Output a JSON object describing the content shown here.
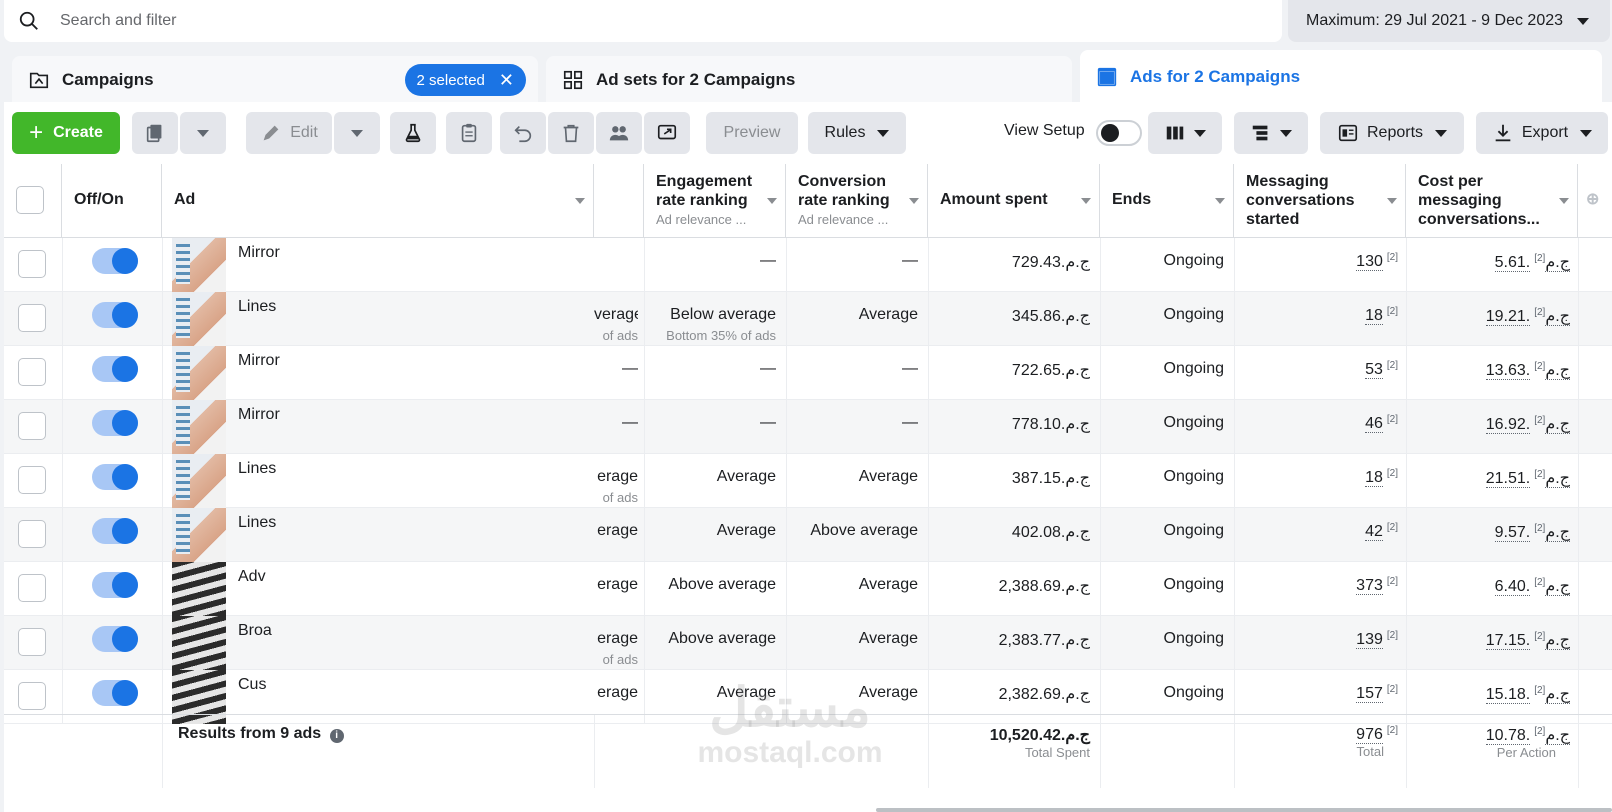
{
  "search": {
    "placeholder": "Search and filter"
  },
  "date_range": {
    "label": "Maximum: 29 Jul 2021 - 9 Dec 2023"
  },
  "tabs": [
    {
      "label": "Campaigns",
      "badge": "2 selected"
    },
    {
      "label": "Ad sets for 2 Campaigns"
    },
    {
      "label": "Ads for 2 Campaigns"
    }
  ],
  "toolbar": {
    "create": "Create",
    "edit": "Edit",
    "preview": "Preview",
    "rules": "Rules",
    "view_setup": "View Setup",
    "reports": "Reports",
    "export": "Export"
  },
  "columns": {
    "off_on": "Off/On",
    "ad": "Ad",
    "engagement_line1": "Engagement",
    "engagement_line2": "rate ranking",
    "engagement_sub": "Ad relevance ...",
    "conversion_line1": "Conversion",
    "conversion_line2": "rate ranking",
    "conversion_sub": "Ad relevance ...",
    "amount_spent": "Amount spent",
    "ends": "Ends",
    "messaging_line1": "Messaging",
    "messaging_line2": "conversations",
    "messaging_line3": "started",
    "cost_line1": "Cost per",
    "cost_line2": "messaging",
    "cost_line3": "conversations..."
  },
  "rows": [
    {
      "name": "Mirror",
      "thumb": "face",
      "quality": "",
      "quality_sub": "",
      "engagement": "—",
      "engagement_sub": "",
      "conversion": "—",
      "amount": "729.43.ج.م",
      "ends": "Ongoing",
      "messaging": "130",
      "cost": "5.61.ج.م"
    },
    {
      "name": "Lines",
      "thumb": "face",
      "quality": "verage",
      "quality_sub": "of ads",
      "engagement": "Below average",
      "engagement_sub": "Bottom 35% of ads",
      "conversion": "Average",
      "amount": "345.86.ج.م",
      "ends": "Ongoing",
      "messaging": "18",
      "cost": "19.21.ج.م"
    },
    {
      "name": "Mirror",
      "thumb": "face",
      "quality": "—",
      "quality_sub": "",
      "engagement": "—",
      "engagement_sub": "",
      "conversion": "—",
      "amount": "722.65.ج.م",
      "ends": "Ongoing",
      "messaging": "53",
      "cost": "13.63.ج.م"
    },
    {
      "name": "Mirror",
      "thumb": "face",
      "quality": "—",
      "quality_sub": "",
      "engagement": "—",
      "engagement_sub": "",
      "conversion": "—",
      "amount": "778.10.ج.م",
      "ends": "Ongoing",
      "messaging": "46",
      "cost": "16.92.ج.م"
    },
    {
      "name": "Lines",
      "thumb": "face",
      "quality": "erage",
      "quality_sub": "of ads",
      "engagement": "Average",
      "engagement_sub": "",
      "conversion": "Average",
      "amount": "387.15.ج.م",
      "ends": "Ongoing",
      "messaging": "18",
      "cost": "21.51.ج.م"
    },
    {
      "name": "Lines",
      "thumb": "face",
      "quality": "erage",
      "quality_sub": "",
      "engagement": "Average",
      "engagement_sub": "",
      "conversion": "Above average",
      "amount": "402.08.ج.م",
      "ends": "Ongoing",
      "messaging": "42",
      "cost": "9.57.ج.م"
    },
    {
      "name": "Adv",
      "thumb": "stripe",
      "quality": "erage",
      "quality_sub": "",
      "engagement": "Above average",
      "engagement_sub": "",
      "conversion": "Average",
      "amount": "2,388.69.ج.م",
      "ends": "Ongoing",
      "messaging": "373",
      "cost": "6.40.ج.م"
    },
    {
      "name": "Broa",
      "thumb": "stripe",
      "quality": "erage",
      "quality_sub": "of ads",
      "engagement": "Above average",
      "engagement_sub": "",
      "conversion": "Average",
      "amount": "2,383.77.ج.م",
      "ends": "Ongoing",
      "messaging": "139",
      "cost": "17.15.ج.م"
    },
    {
      "name": "Cus",
      "thumb": "stripe",
      "quality": "erage",
      "quality_sub": "",
      "engagement": "Average",
      "engagement_sub": "",
      "conversion": "Average",
      "amount": "2,382.69.ج.م",
      "ends": "Ongoing",
      "messaging": "157",
      "cost": "15.18.ج.م"
    }
  ],
  "footnote_mark": "[2]",
  "footer": {
    "results": "Results from 9 ads",
    "total_spent": "10,520.42.ج.م",
    "total_spent_label": "Total Spent",
    "total_messaging": "976",
    "total_messaging_label": "Total",
    "per_action": "10.78.ج.م",
    "per_action_label": "Per Action"
  },
  "watermark": {
    "arabic": "مستقل",
    "latin": "mostaql.com"
  },
  "colors": {
    "accent": "#1b74e4",
    "create": "#42b72a"
  }
}
